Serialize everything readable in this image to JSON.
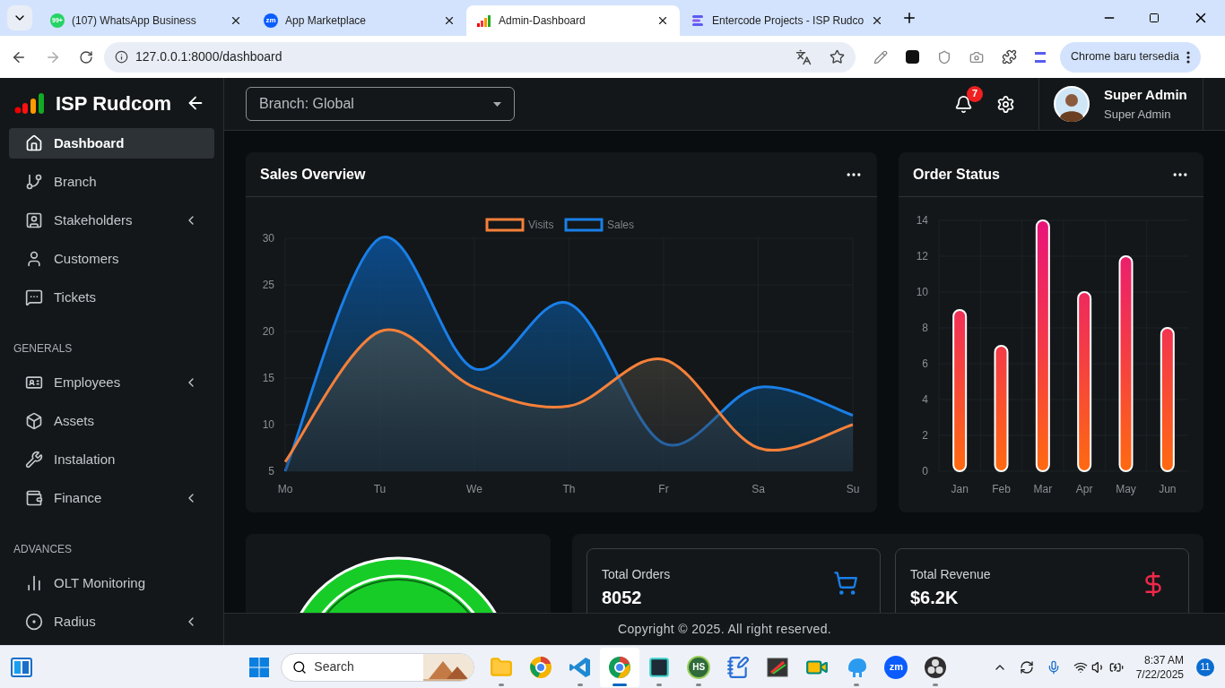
{
  "browser": {
    "tabs": [
      {
        "kind": "whatsapp",
        "badge": "99+",
        "title": "(107) WhatsApp Business",
        "selected": false
      },
      {
        "kind": "zm",
        "logo": "zm",
        "title": "App Marketplace",
        "selected": false
      },
      {
        "kind": "bars",
        "title": "Admin-Dashboard",
        "selected": true
      },
      {
        "kind": "entercode",
        "title": "Entercode Projects - ISP Rudco",
        "selected": false
      }
    ],
    "address": "127.0.0.1:8000/dashboard",
    "update_button": "Chrome baru tersedia"
  },
  "app": {
    "brand": "ISP Rudcom",
    "sidebar": [
      {
        "items": [
          {
            "label": "Dashboard",
            "selected": true,
            "has_submenu": false
          },
          {
            "label": "Branch",
            "selected": false,
            "has_submenu": false
          },
          {
            "label": "Stakeholders",
            "selected": false,
            "has_submenu": true
          },
          {
            "label": "Customers",
            "selected": false,
            "has_submenu": false
          },
          {
            "label": "Tickets",
            "selected": false,
            "has_submenu": false
          }
        ]
      },
      {
        "title": "GENERALS",
        "items": [
          {
            "label": "Employees",
            "selected": false,
            "has_submenu": true
          },
          {
            "label": "Assets",
            "selected": false,
            "has_submenu": false
          },
          {
            "label": "Instalation",
            "selected": false,
            "has_submenu": false
          },
          {
            "label": "Finance",
            "selected": false,
            "has_submenu": true
          }
        ]
      },
      {
        "title": "ADVANCES",
        "items": [
          {
            "label": "OLT Monitoring",
            "selected": false,
            "has_submenu": false
          },
          {
            "label": "Radius",
            "selected": false,
            "has_submenu": true
          }
        ]
      }
    ],
    "header": {
      "branch_select": "Branch: Global",
      "notification_count": "7",
      "user": {
        "name": "Super Admin",
        "role": "Super Admin"
      }
    },
    "sales_card": {
      "title": "Sales Overview",
      "chart_data": {
        "type": "area",
        "grid": true,
        "legend": true,
        "categories": [
          "Mo",
          "Tu",
          "We",
          "Th",
          "Fr",
          "Sa",
          "Su"
        ],
        "ylim": [
          5,
          30
        ],
        "yticks": [
          5,
          10,
          15,
          20,
          25,
          30
        ],
        "series": [
          {
            "name": "Visits",
            "color": "#f5803a",
            "values": [
              6,
              20,
              14,
              12,
              17,
              7.5,
              10
            ]
          },
          {
            "name": "Sales",
            "color": "#1a7fe8",
            "values": [
              5,
              30,
              16,
              23,
              8,
              14,
              11
            ]
          }
        ]
      }
    },
    "orders_card": {
      "title": "Order Status",
      "chart_data": {
        "type": "bar",
        "grid": true,
        "categories": [
          "Jan",
          "Feb",
          "Mar",
          "Apr",
          "May",
          "Jun"
        ],
        "values": [
          9,
          7,
          14,
          10,
          12,
          8
        ],
        "ylim": [
          0,
          14
        ],
        "yticks": [
          0,
          2,
          4,
          6,
          8,
          10,
          12,
          14
        ]
      }
    },
    "stats": [
      {
        "label": "Total Orders",
        "value": "8052",
        "kind": "cart",
        "color": "#1a7fe8"
      },
      {
        "label": "Total Revenue",
        "value": "$6.2K",
        "kind": "dollar",
        "color": "#f0284a"
      }
    ],
    "footer": "Copyright © 2025. All right reserved."
  },
  "taskbar": {
    "search": "Search",
    "apps": [
      {
        "kind": "folder",
        "running": true,
        "active": false
      },
      {
        "kind": "browser2",
        "running": false,
        "active": false
      },
      {
        "kind": "code",
        "running": true,
        "active": false
      },
      {
        "kind": "browser",
        "running": true,
        "active": true
      },
      {
        "kind": "terminal",
        "running": true,
        "active": false
      },
      {
        "kind": "text",
        "label": "HS",
        "running": true,
        "active": false
      },
      {
        "kind": "notepad",
        "running": false,
        "active": false
      },
      {
        "kind": "window",
        "running": false,
        "active": false
      },
      {
        "kind": "video",
        "running": false,
        "active": false
      },
      {
        "kind": "elephant",
        "running": true,
        "active": false
      },
      {
        "kind": "zm",
        "label": "zm",
        "running": false,
        "active": false
      },
      {
        "kind": "record",
        "running": true,
        "active": false
      }
    ],
    "time": "8:37 AM",
    "date": "7/22/2025",
    "notifications": "11"
  }
}
